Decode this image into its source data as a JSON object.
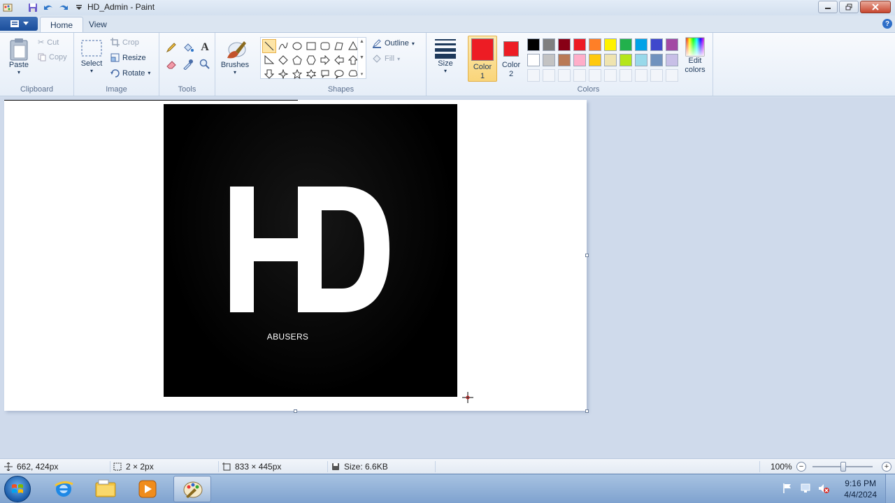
{
  "window": {
    "title": "HD_Admin - Paint",
    "controls": {
      "minimize_icon": "minimize-icon",
      "maximize_icon": "restore-icon",
      "close_icon": "close-icon"
    }
  },
  "quick_access": [
    "paint-app-icon",
    "save-icon",
    "undo-icon",
    "redo-icon",
    "customize-dropdown-icon"
  ],
  "tabs": [
    {
      "label": "Home",
      "active": true
    },
    {
      "label": "View",
      "active": false
    }
  ],
  "ribbon": {
    "clipboard": {
      "group_label": "Clipboard",
      "paste_label": "Paste",
      "cut_label": "Cut",
      "copy_label": "Copy"
    },
    "image": {
      "group_label": "Image",
      "select_label": "Select",
      "crop_label": "Crop",
      "resize_label": "Resize",
      "rotate_label": "Rotate"
    },
    "tools": {
      "group_label": "Tools",
      "items": [
        "pencil-icon",
        "fill-bucket-icon",
        "text-icon",
        "eraser-icon",
        "color-picker-icon",
        "magnifier-icon"
      ]
    },
    "brushes": {
      "label": "Brushes"
    },
    "shapes": {
      "group_label": "Shapes",
      "outline_label": "Outline",
      "fill_label": "Fill"
    },
    "size": {
      "label": "Size"
    },
    "colors": {
      "group_label": "Colors",
      "color1_label": "Color 1",
      "color1_label_a": "Color",
      "color1_label_b": "1",
      "color2_label_a": "Color",
      "color2_label_b": "2",
      "color1": "#ed1c24",
      "color2": "#ed1c24",
      "edit_label_a": "Edit",
      "edit_label_b": "colors",
      "palette_row1": [
        "#000000",
        "#7f7f7f",
        "#880015",
        "#ed1c24",
        "#ff7f27",
        "#fff200",
        "#22b14c",
        "#00a2e8",
        "#3f48cc",
        "#a349a4"
      ],
      "palette_row2": [
        "#ffffff",
        "#c3c3c3",
        "#b97a57",
        "#ffaec9",
        "#ffc90e",
        "#efe4b0",
        "#b5e61d",
        "#99d9ea",
        "#7092be",
        "#c8bfe7"
      ],
      "palette_row3_count": 10
    }
  },
  "canvas": {
    "image_text": "HD",
    "caption": "ABUSERS"
  },
  "status": {
    "cursor_pos": "662, 424px",
    "selection_size": "2 × 2px",
    "image_size": "833 × 445px",
    "file_size": "Size: 6.6KB",
    "zoom": "100%",
    "zoom_fraction": 0.5
  },
  "taskbar": {
    "items": [
      {
        "name": "internet-explorer-icon",
        "active": false
      },
      {
        "name": "file-explorer-icon",
        "active": false
      },
      {
        "name": "media-player-icon",
        "active": false
      },
      {
        "name": "paint-taskbar-icon",
        "active": true
      }
    ],
    "tray": [
      "action-center-flag-icon",
      "network-icon",
      "volume-muted-icon"
    ],
    "time": "9:16 PM",
    "date": "4/4/2024"
  }
}
